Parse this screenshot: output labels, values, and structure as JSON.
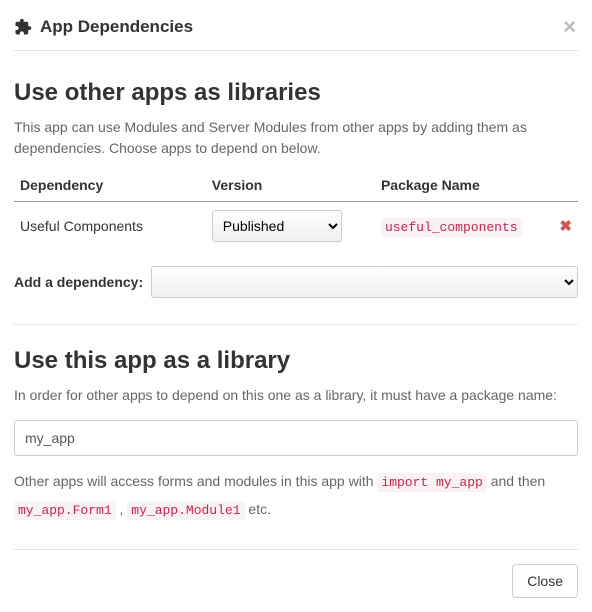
{
  "header": {
    "title": "App Dependencies"
  },
  "deps_section": {
    "title": "Use other apps as libraries",
    "desc": "This app can use Modules and Server Modules from other apps by adding them as dependencies. Choose apps to depend on below.",
    "columns": {
      "dependency": "Dependency",
      "version": "Version",
      "package": "Package Name"
    },
    "rows": [
      {
        "name": "Useful Components",
        "version": "Published",
        "package": "useful_components"
      }
    ],
    "add_label": "Add a dependency:"
  },
  "lib_section": {
    "title": "Use this app as a library",
    "desc": "In order for other apps to depend on this one as a library, it must have a package name:",
    "package_value": "my_app",
    "footer_pre": "Other apps will access forms and modules in this app with ",
    "footer_code1": "import my_app",
    "footer_mid": " and then ",
    "footer_code2": "my_app.Form1",
    "footer_sep": " , ",
    "footer_code3": "my_app.Module1",
    "footer_post": " etc."
  },
  "footer": {
    "close": "Close"
  }
}
